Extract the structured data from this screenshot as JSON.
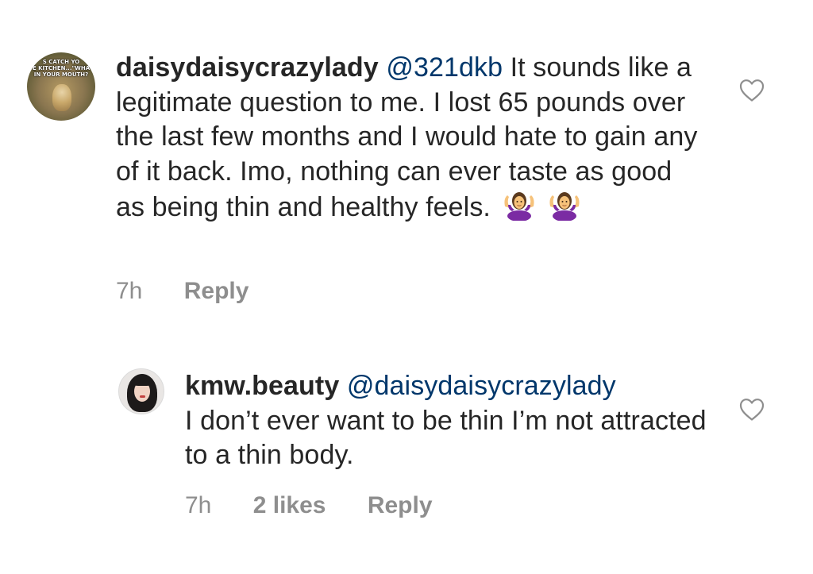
{
  "comments": [
    {
      "username": "daisydaisycrazylady",
      "mention": "@321dkb",
      "text": "It sounds like a legitimate question to me. I lost 65 pounds over the last few months and I would hate to gain any of it back. Imo, nothing can ever taste as good as being thin and healthy feels.",
      "emoji": "woman-shrugging-emoji",
      "time": "7h",
      "reply_label": "Reply",
      "avatar_text": "...S CATCH YOU ...E KITCHEN ... \"WHAT ... IN YOUR MOUTH?\"",
      "like_icon": "heart-outline-icon"
    },
    {
      "username": "kmw.beauty",
      "mention": "@daisydaisycrazylady",
      "text": "I don’t ever want to be thin I’m not attracted to a thin body.",
      "time": "7h",
      "likes": "2 likes",
      "reply_label": "Reply",
      "like_icon": "heart-outline-icon"
    }
  ],
  "colors": {
    "text": "#262626",
    "mention": "#00376b",
    "meta": "#8e8e8e",
    "background": "#ffffff"
  }
}
